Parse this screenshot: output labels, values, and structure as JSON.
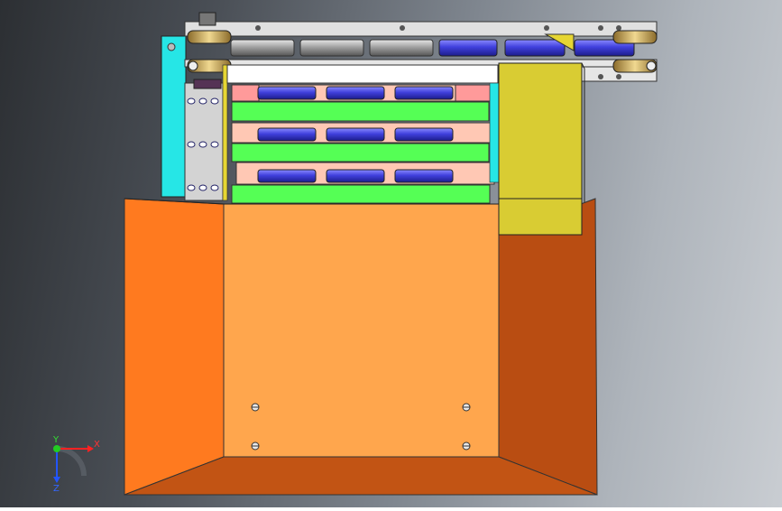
{
  "viewport": {
    "background_colors": [
      "#2c2f33",
      "#c9cdd2"
    ]
  },
  "model": {
    "colors": {
      "bin_left_wall": "#ff7a1f",
      "bin_back_wall": "#ffa64d",
      "bin_right_wall": "#b94d12",
      "bin_floor": "#c25414",
      "side_plate": "#26e6e6",
      "shelf_green": "#55ff55",
      "pad_pink": "#ffc8b4",
      "roller_blue": "#4040dd",
      "roller_grey": "#a8a8a8",
      "pusher_yellow": "#d9cc33",
      "frame_grey": "#d9d9d9"
    }
  },
  "triad": {
    "x_label": "X",
    "y_label": "Y",
    "z_label": "Z",
    "x_color": "#ff2222",
    "y_color": "#22cc22",
    "z_color": "#2255ff"
  }
}
